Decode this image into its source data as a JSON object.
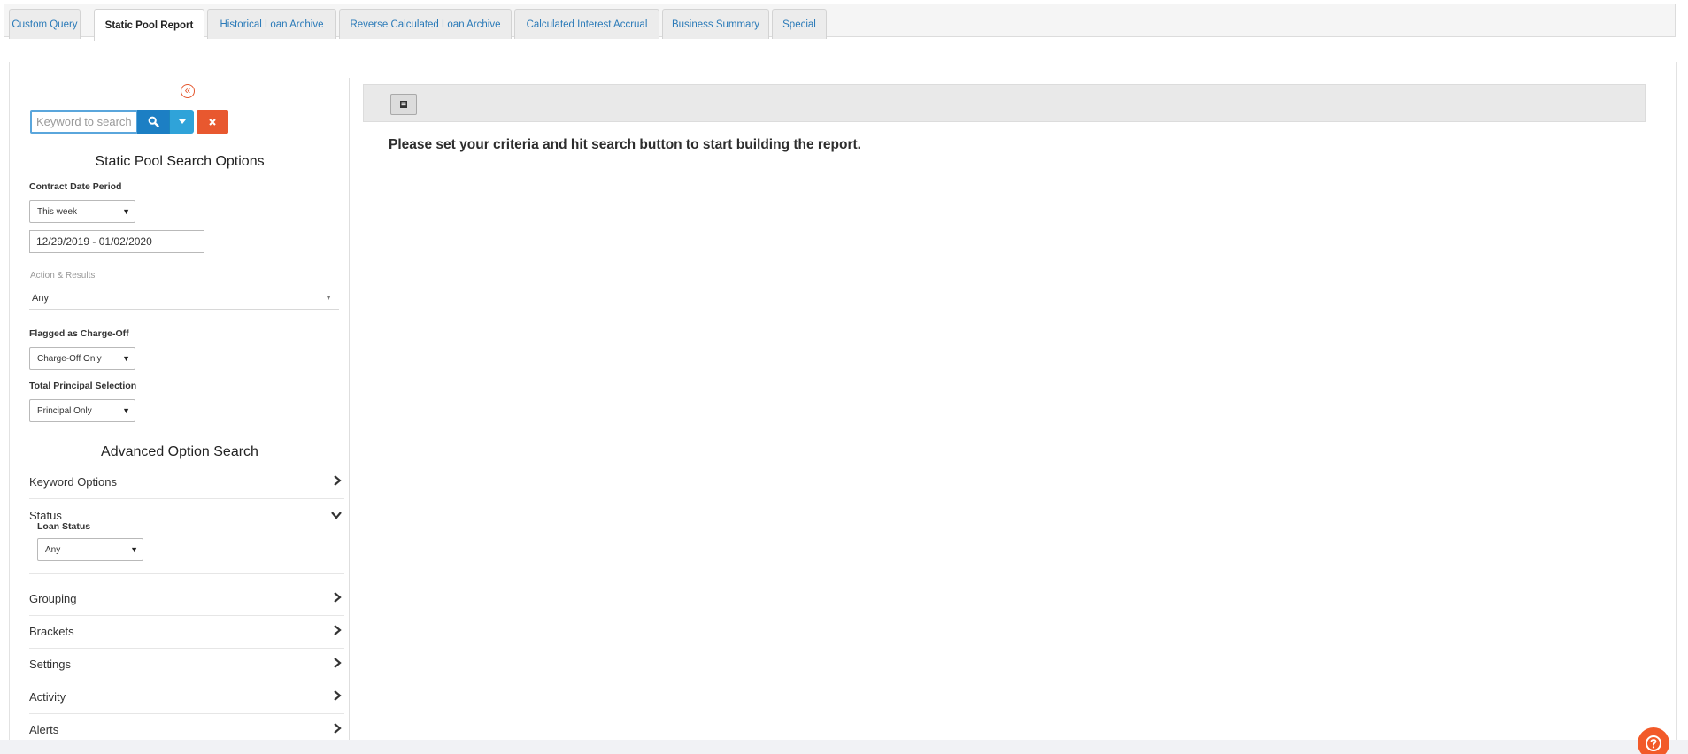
{
  "tabs": [
    {
      "label": "Custom Query",
      "active": false
    },
    {
      "label": "Static Pool Report",
      "active": true
    },
    {
      "label": "Historical Loan Archive",
      "active": false
    },
    {
      "label": "Reverse Calculated Loan Archive",
      "active": false
    },
    {
      "label": "Calculated Interest Accrual",
      "active": false
    },
    {
      "label": "Business Summary",
      "active": false
    },
    {
      "label": "Special",
      "active": false
    }
  ],
  "sidebar": {
    "collapse_icon": "double-chevron-left-icon",
    "search": {
      "placeholder": "Keyword to search",
      "value": ""
    },
    "search_options_heading": "Static Pool Search Options",
    "contract_date_period": {
      "label": "Contract Date Period",
      "selected": "This week",
      "range": "12/29/2019 - 01/02/2020"
    },
    "action_results": {
      "label": "Action & Results",
      "selected": "Any"
    },
    "flagged_charge_off": {
      "label": "Flagged as Charge-Off",
      "selected": "Charge-Off Only"
    },
    "total_principal": {
      "label": "Total Principal Selection",
      "selected": "Principal Only"
    },
    "advanced_heading": "Advanced Option Search",
    "accordions": {
      "keyword_options": "Keyword Options",
      "status": "Status",
      "grouping": "Grouping",
      "brackets": "Brackets",
      "settings": "Settings",
      "activity": "Activity",
      "alerts": "Alerts"
    },
    "loan_status": {
      "label": "Loan Status",
      "selected": "Any"
    }
  },
  "main": {
    "message": "Please set your criteria and hit search button to start building the report."
  },
  "colors": {
    "accent_blue": "#1c7fc4",
    "light_blue": "#2fa3d9",
    "danger_orange": "#e8582f",
    "tab_link": "#2a7ab8"
  }
}
